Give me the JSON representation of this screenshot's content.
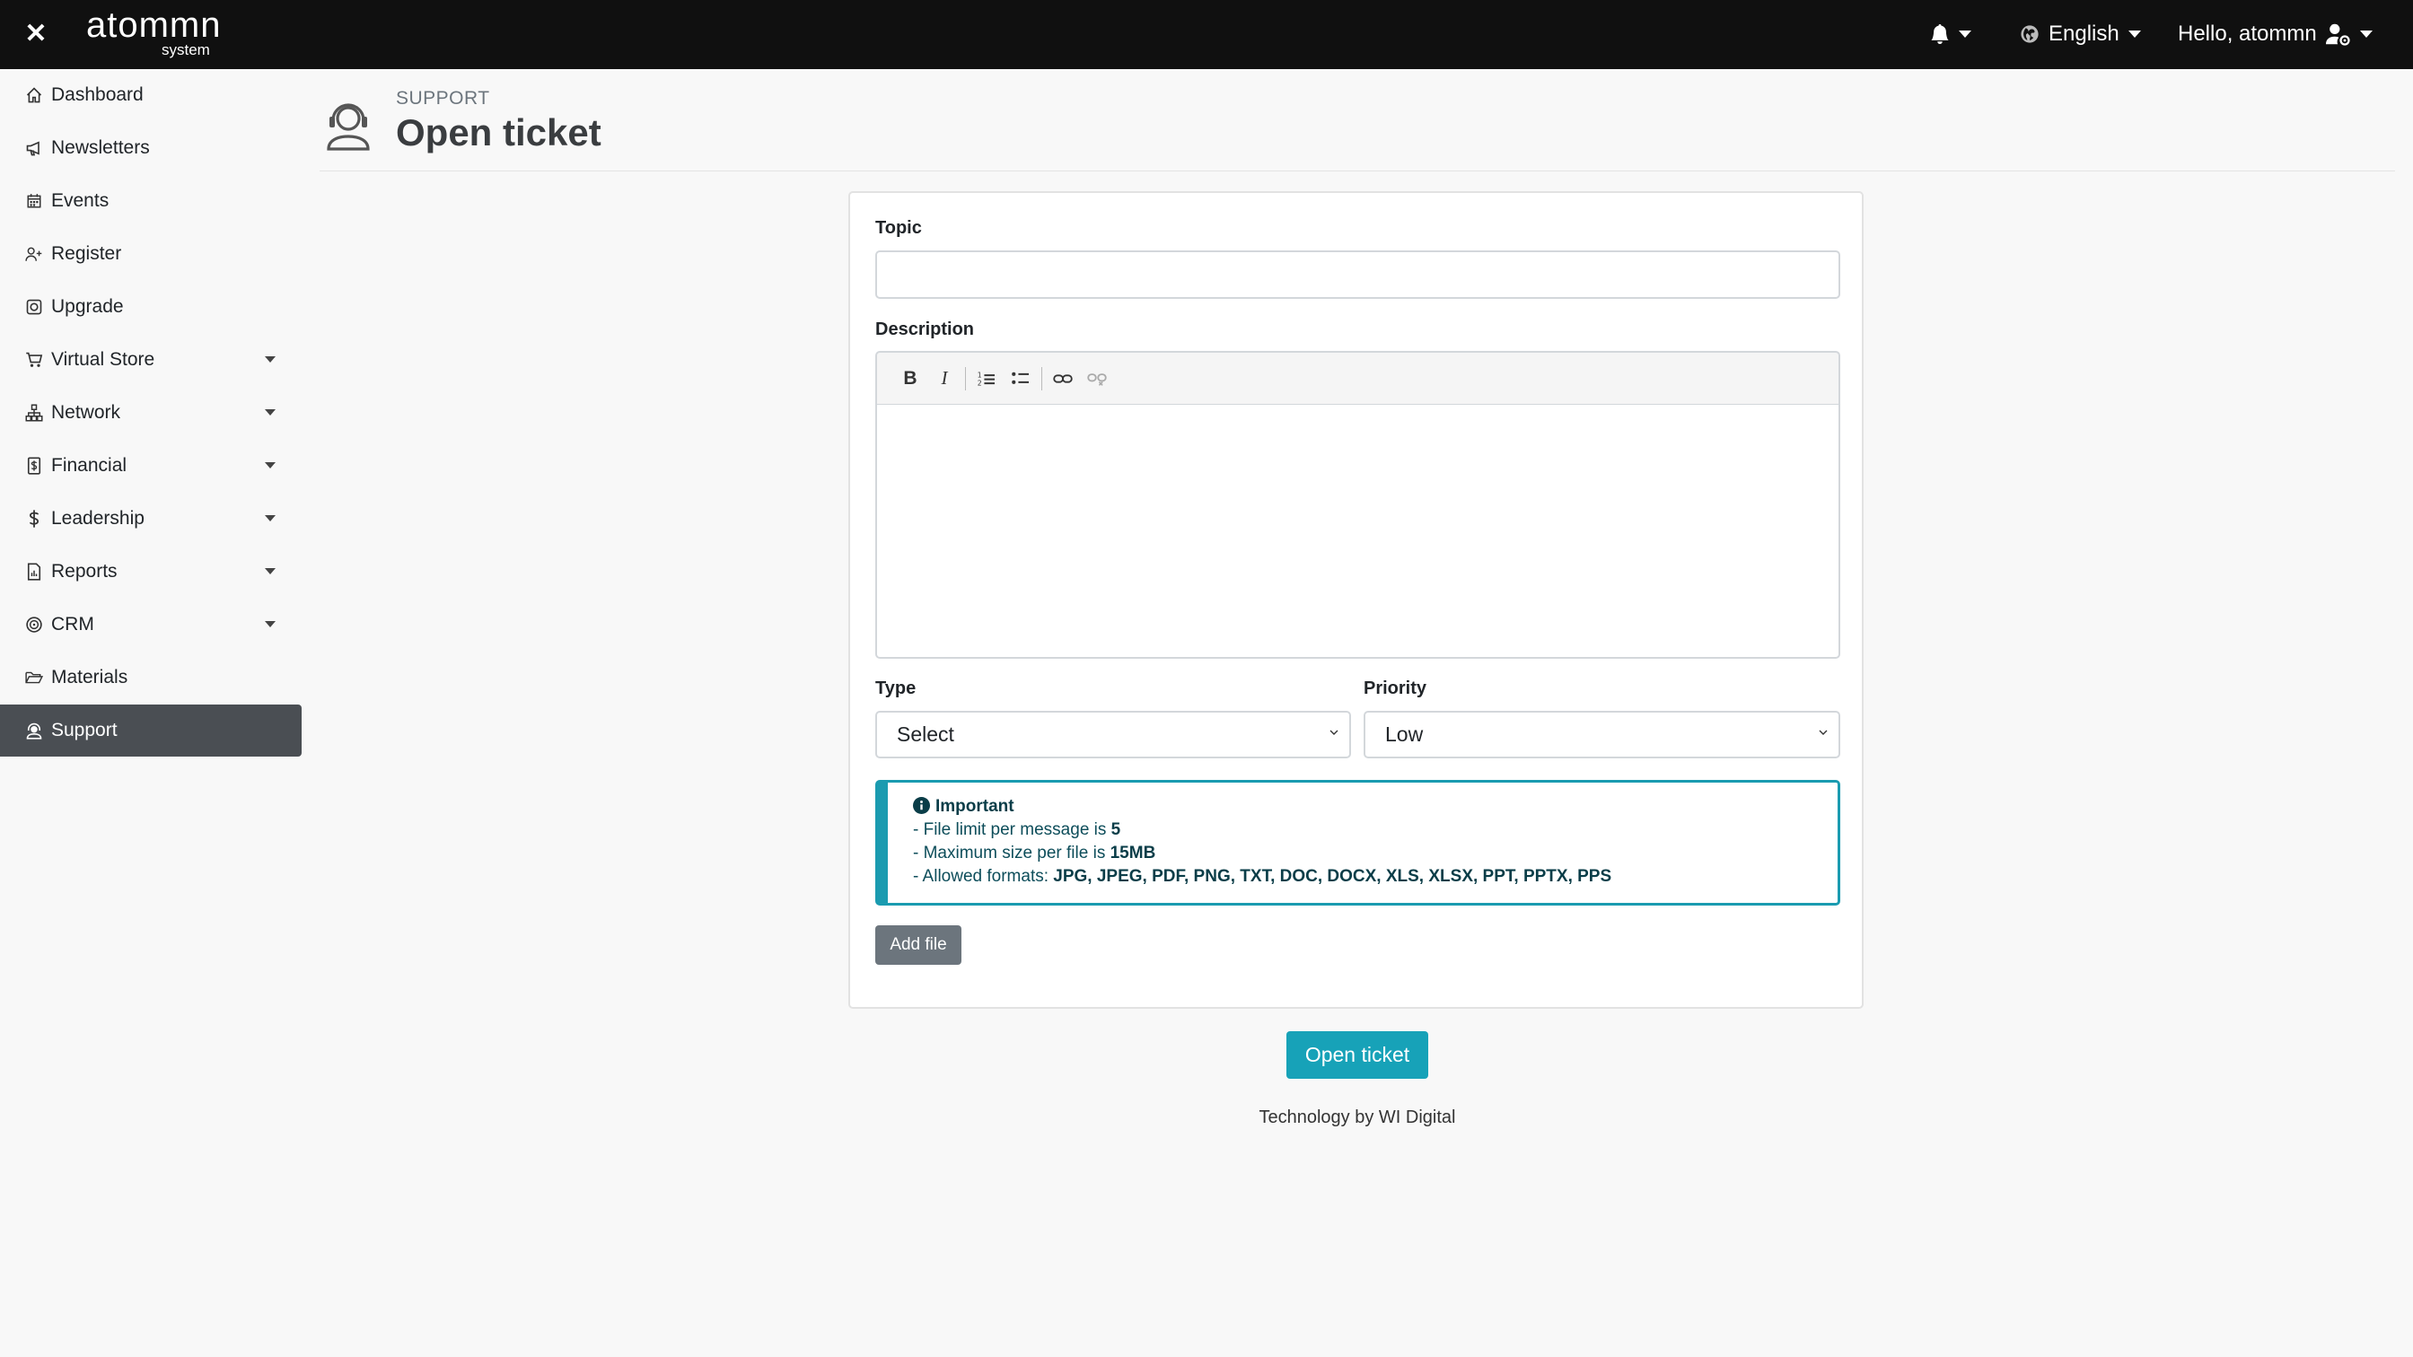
{
  "topbar": {
    "logo_main": "atomm",
    "logo_n": "n",
    "logo_sub": "system",
    "language": "English",
    "greeting": "Hello, atommn"
  },
  "sidebar": {
    "items": [
      {
        "label": "Dashboard",
        "icon": "home-icon",
        "has_submenu": false
      },
      {
        "label": "Newsletters",
        "icon": "megaphone-icon",
        "has_submenu": false
      },
      {
        "label": "Events",
        "icon": "calendar-icon",
        "has_submenu": false
      },
      {
        "label": "Register",
        "icon": "person-add-icon",
        "has_submenu": false
      },
      {
        "label": "Upgrade",
        "icon": "upgrade-icon",
        "has_submenu": false
      },
      {
        "label": "Virtual Store",
        "icon": "cart-icon",
        "has_submenu": true
      },
      {
        "label": "Network",
        "icon": "network-icon",
        "has_submenu": true
      },
      {
        "label": "Financial",
        "icon": "file-dollar-icon",
        "has_submenu": true
      },
      {
        "label": "Leadership",
        "icon": "dollar-icon",
        "has_submenu": true
      },
      {
        "label": "Reports",
        "icon": "report-icon",
        "has_submenu": true
      },
      {
        "label": "CRM",
        "icon": "crm-icon",
        "has_submenu": true
      },
      {
        "label": "Materials",
        "icon": "folder-icon",
        "has_submenu": false
      },
      {
        "label": "Support",
        "icon": "support-icon",
        "has_submenu": false,
        "active": true
      }
    ]
  },
  "header": {
    "kicker": "SUPPORT",
    "title": "Open ticket"
  },
  "form": {
    "topic_label": "Topic",
    "topic_value": "",
    "description_label": "Description",
    "type_label": "Type",
    "type_value": "Select",
    "priority_label": "Priority",
    "priority_value": "Low"
  },
  "alert": {
    "title": "Important",
    "line1_prefix": "- File limit per message is ",
    "line1_value": "5",
    "line2_prefix": "- Maximum size per file is ",
    "line2_value": "15MB",
    "line3_prefix": "- Allowed formats: ",
    "line3_value": "JPG, JPEG, PDF, PNG, TXT, DOC, DOCX, XLS, XLSX, PPT, PPTX, PPS"
  },
  "buttons": {
    "add_file": "Add file",
    "submit": "Open ticket"
  },
  "footer": {
    "text": "Technology by WI Digital"
  },
  "colors": {
    "accent": "#17a2b8",
    "topbar": "#101010",
    "sidebar_active": "#4a4e53"
  }
}
